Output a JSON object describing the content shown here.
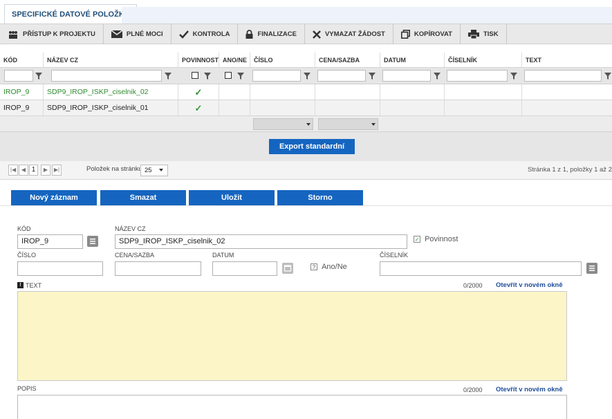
{
  "tab": {
    "label": "SPECIFICKÉ DATOVÉ POLOŽKY"
  },
  "toolbar": {
    "items": [
      {
        "label": "PŘÍSTUP K PROJEKTU",
        "icon": "people-icon"
      },
      {
        "label": "PLNÉ MOCI",
        "icon": "envelope-icon"
      },
      {
        "label": "KONTROLA",
        "icon": "check-icon"
      },
      {
        "label": "FINALIZACE",
        "icon": "lock-icon"
      },
      {
        "label": "VYMAZAT ŽÁDOST",
        "icon": "x-icon"
      },
      {
        "label": "KOPÍROVAT",
        "icon": "copy-icon"
      },
      {
        "label": "TISK",
        "icon": "printer-icon"
      }
    ]
  },
  "grid": {
    "columns": [
      "KÓD",
      "NÁZEV CZ",
      "POVINNOST",
      "ANO/NE",
      "ČÍSLO",
      "CENA/SAZBA",
      "DATUM",
      "ČÍSELNÍK",
      "TEXT"
    ],
    "rows": [
      {
        "kod": "IROP_9",
        "nazev": "SDP9_IROP_ISKP_ciselnik_02",
        "povinnost": "✓"
      },
      {
        "kod": "IROP_9",
        "nazev": "SDP9_IROP_ISKP_ciselnik_01",
        "povinnost": "✓"
      }
    ]
  },
  "export": {
    "label": "Export standardní"
  },
  "pager": {
    "page": "1",
    "per_page_label": "Položek na stránku",
    "per_page": "25",
    "info": "Stránka 1 z 1, položky 1 až 2 z 2"
  },
  "actions": {
    "new": "Nový záznam",
    "delete": "Smazat",
    "save": "Uložit",
    "cancel": "Storno"
  },
  "form": {
    "kod_label": "KÓD",
    "kod_value": "IROP_9",
    "nazev_label": "NÁZEV CZ",
    "nazev_value": "SDP9_IROP_ISKP_ciselnik_02",
    "povinnost_label": "Povinnost",
    "cislo_label": "ČÍSLO",
    "cena_label": "CENA/SAZBA",
    "datum_label": "DATUM",
    "ano_ne_label": "Ano/Ne",
    "ciselnik_label": "ČÍSELNÍK",
    "text_label": "TEXT",
    "text_counter": "0/2000",
    "text_open": "Otevřít v novém okně",
    "popis_label": "POPIS",
    "popis_counter": "0/2000",
    "popis_open": "Otevřít v novém okně"
  },
  "colors": {
    "accent": "#1565c0",
    "selected_row_text": "#2e8b2e",
    "textarea_bg": "#fbf5c7"
  }
}
